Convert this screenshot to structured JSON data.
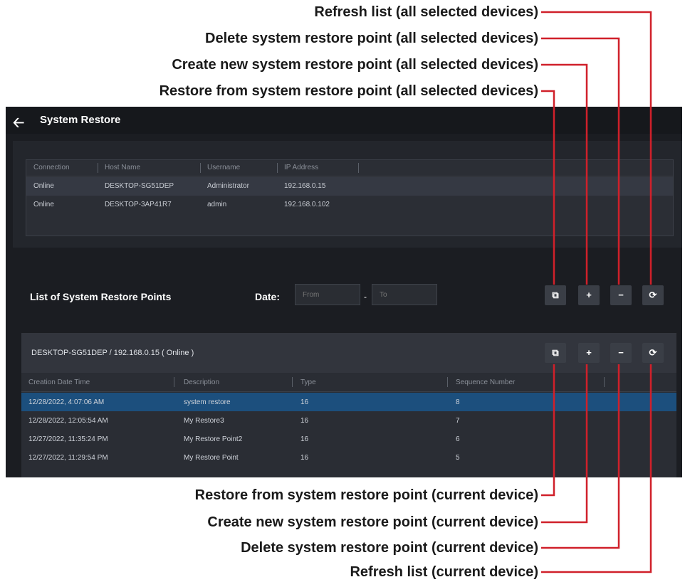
{
  "callouts": {
    "refresh_all": "Refresh list (all selected devices)",
    "delete_all": "Delete system restore point (all selected devices)",
    "create_all": "Create new system restore point (all selected devices)",
    "restore_all": "Restore from system restore point (all selected devices)",
    "restore_current": "Restore from system restore point (current device)",
    "create_current": "Create new system restore point (current device)",
    "delete_current": "Delete system restore point (current device)",
    "refresh_current": "Refresh list (current device)"
  },
  "colors": {
    "callout_line": "#d0202a",
    "selection": "#1c4f7d",
    "background": "#1b1d22"
  },
  "app": {
    "back_icon": "arrow-left-icon",
    "title": "System Restore",
    "devices": {
      "columns": [
        "Connection",
        "Host Name",
        "Username",
        "IP Address"
      ],
      "rows": [
        [
          "Online",
          "DESKTOP-SG51DEP",
          "Administrator",
          "192.168.0.15"
        ],
        [
          "Online",
          "DESKTOP-3AP41R7",
          "admin",
          "192.168.0.102"
        ]
      ]
    },
    "list_title": "List of System Restore Points",
    "date_label": "Date:",
    "date_from_placeholder": "From",
    "date_to_placeholder": "To",
    "date_separator": "-",
    "toolbar_icons": {
      "restore": "restore-icon",
      "create": "plus-icon",
      "delete": "minus-icon",
      "refresh": "refresh-icon"
    },
    "toolbar_glyphs": {
      "restore": "⧉",
      "create": "+",
      "delete": "−",
      "refresh": "⟳"
    },
    "current_device": {
      "label": "DESKTOP-SG51DEP / 192.168.0.15 ( Online )",
      "columns": [
        "Creation Date Time",
        "Description",
        "Type",
        "Sequence Number"
      ],
      "rows": [
        [
          "12/28/2022, 4:07:06 AM",
          "system restore",
          "16",
          "8"
        ],
        [
          "12/28/2022, 12:05:54 AM",
          "My Restore3",
          "16",
          "7"
        ],
        [
          "12/27/2022, 11:35:24 PM",
          "My Restore Point2",
          "16",
          "6"
        ],
        [
          "12/27/2022, 11:29:54 PM",
          "My Restore Point",
          "16",
          "5"
        ]
      ]
    }
  }
}
